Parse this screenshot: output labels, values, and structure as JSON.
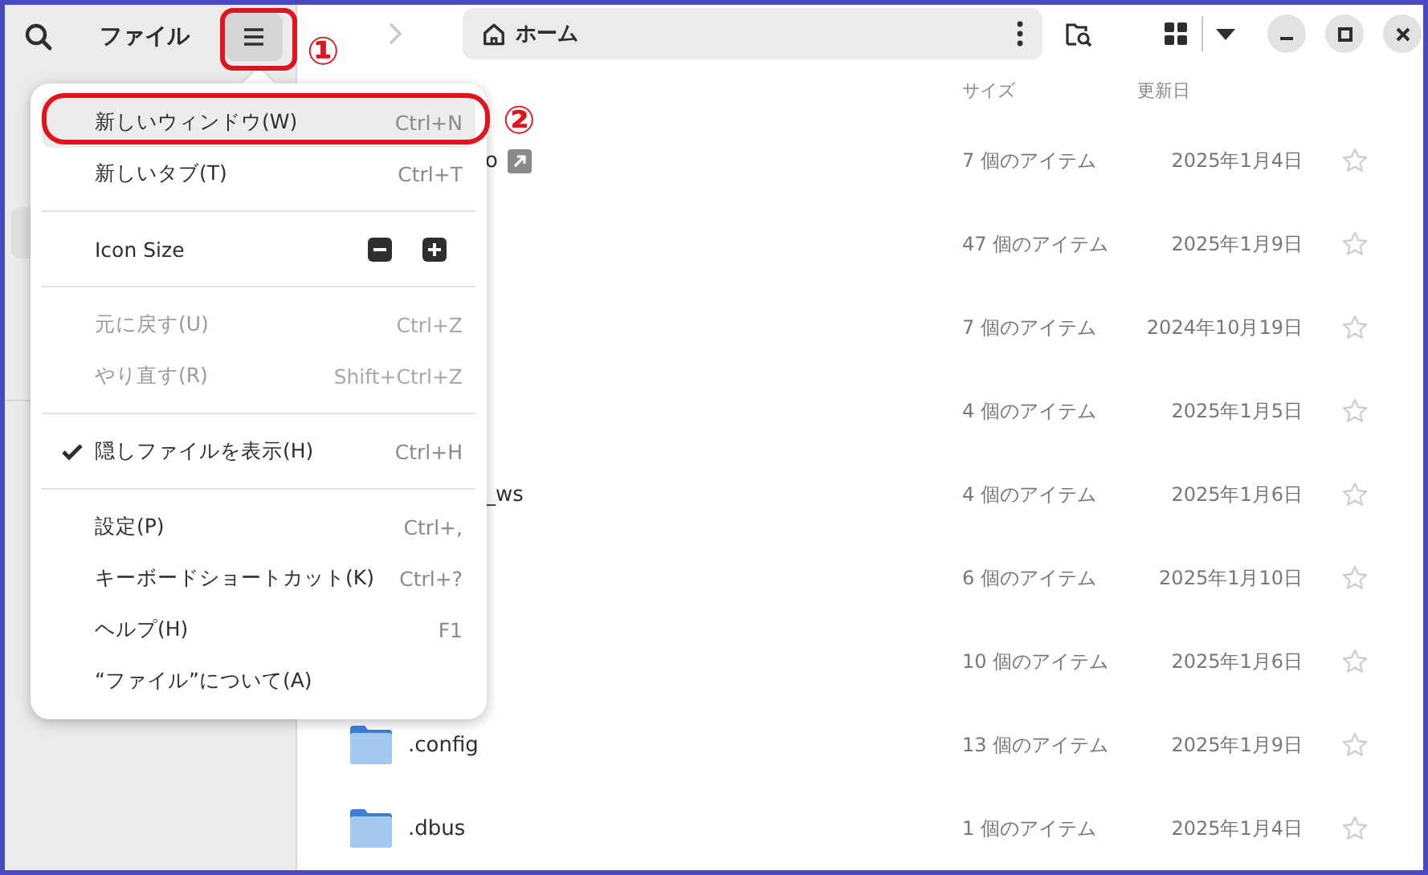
{
  "header": {
    "title": "ファイル",
    "location": "ホーム"
  },
  "columns": [
    "サイズ",
    "更新日"
  ],
  "rows": [
    {
      "kind": "covered",
      "name": "o",
      "linked": true,
      "size": "7 個のアイテム",
      "modified": "2025年1月4日",
      "starred": false
    },
    {
      "kind": "hidden",
      "size": "47 個のアイテム",
      "modified": "2025年1月9日",
      "starred": false
    },
    {
      "kind": "hidden",
      "size": "7 個のアイテム",
      "modified": "2024年10月19日",
      "starred": false
    },
    {
      "kind": "hidden",
      "size": "4 個のアイテム",
      "modified": "2025年1月5日",
      "starred": false
    },
    {
      "kind": "covered",
      "name": "_ws",
      "linked": false,
      "size": "4 個のアイテム",
      "modified": "2025年1月6日",
      "starred": false
    },
    {
      "kind": "hidden",
      "size": "6 個のアイテム",
      "modified": "2025年1月10日",
      "starred": false
    },
    {
      "kind": "hidden",
      "size": "10 個のアイテム",
      "modified": "2025年1月6日",
      "starred": false
    },
    {
      "kind": "folder",
      "name": ".config",
      "size": "13 個のアイテム",
      "modified": "2025年1月9日",
      "starred": false
    },
    {
      "kind": "folder",
      "name": ".dbus",
      "size": "1 個のアイテム",
      "modified": "2025年1月4日",
      "starred": false
    }
  ],
  "menu": [
    {
      "kind": "item",
      "label": "新しいウィンドウ(W)",
      "shortcut": "Ctrl+N",
      "selected": true,
      "disabled": false,
      "checked": false
    },
    {
      "kind": "item",
      "label": "新しいタブ(T)",
      "shortcut": "Ctrl+T",
      "selected": false,
      "disabled": false,
      "checked": false
    },
    {
      "kind": "divider"
    },
    {
      "kind": "zoom",
      "label": "Icon Size"
    },
    {
      "kind": "divider"
    },
    {
      "kind": "item",
      "label": "元に戻す(U)",
      "shortcut": "Ctrl+Z",
      "selected": false,
      "disabled": true,
      "checked": false
    },
    {
      "kind": "item",
      "label": "やり直す(R)",
      "shortcut": "Shift+Ctrl+Z",
      "selected": false,
      "disabled": true,
      "checked": false
    },
    {
      "kind": "divider"
    },
    {
      "kind": "item",
      "label": "隠しファイルを表示(H)",
      "shortcut": "Ctrl+H",
      "selected": false,
      "disabled": false,
      "checked": true
    },
    {
      "kind": "divider"
    },
    {
      "kind": "item",
      "label": "設定(P)",
      "shortcut": "Ctrl+,",
      "selected": false,
      "disabled": false,
      "checked": false
    },
    {
      "kind": "item",
      "label": "キーボードショートカット(K)",
      "shortcut": "Ctrl+?",
      "selected": false,
      "disabled": false,
      "checked": false
    },
    {
      "kind": "item",
      "label": "ヘルプ(H)",
      "shortcut": "F1",
      "selected": false,
      "disabled": false,
      "checked": false
    },
    {
      "kind": "item",
      "label": "“ファイル”について(A)",
      "selected": false,
      "disabled": false,
      "checked": false
    }
  ],
  "annotations": [
    "①",
    "②"
  ]
}
